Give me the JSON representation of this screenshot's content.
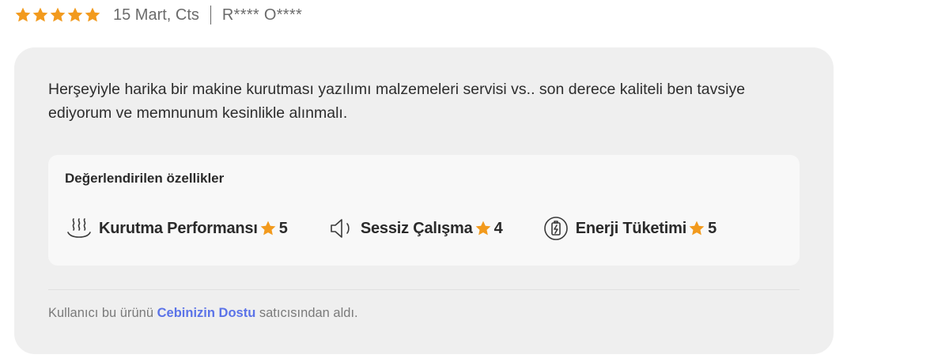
{
  "review": {
    "rating": 5,
    "rating_max": 5,
    "date": "15 Mart, Cts",
    "separator": "|",
    "user": "R**** O****",
    "text": "Herşeyiyle harika bir makine kurutması yazılımı malzemeleri servisi vs.. son derece kaliteli ben tavsiye ediyorum ve memnunum kesinlikle alınmalı.",
    "star_color": "#f29a1d"
  },
  "features": {
    "title": "Değerlendirilen özellikler",
    "items": [
      {
        "icon": "heat-waves-icon",
        "label": "Kurutma Performansı",
        "score": "5"
      },
      {
        "icon": "speaker-icon",
        "label": "Sessiz Çalışma",
        "score": "4"
      },
      {
        "icon": "battery-icon",
        "label": "Enerji Tüketimi",
        "score": "5"
      }
    ]
  },
  "seller": {
    "prefix": "Kullanıcı bu ürünü",
    "name": "Cebinizin Dostu",
    "suffix": "satıcısından aldı.",
    "link_color": "#5b73e8"
  }
}
